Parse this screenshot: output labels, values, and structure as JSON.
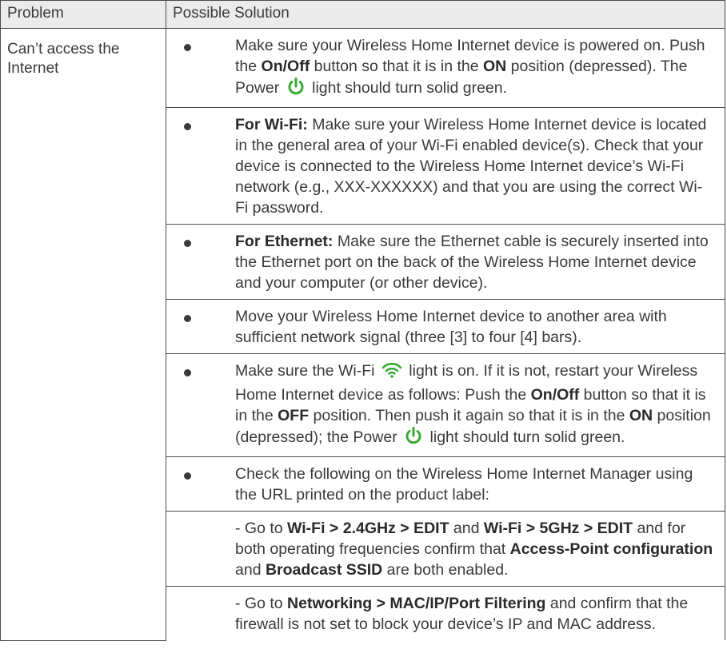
{
  "header": {
    "problem": "Problem",
    "solution": "Possible Solution"
  },
  "problem": "Can’t access the Internet",
  "items": [
    {
      "p1": "Make sure your Wireless Home Internet device is powered on. Push the ",
      "b1": "On/Off",
      "p2": " button so that it is in the ",
      "b2": "ON",
      "p3": " position (depressed). The Power ",
      "p4": " light should turn solid green."
    },
    {
      "b1": "For Wi-Fi:",
      "p1": " Make sure your Wireless Home Internet device is located in the general area of your Wi-Fi enabled device(s). Check that your device is connected to the Wireless Home Internet device’s Wi-Fi network (e.g., XXX-XXXXXX) and that you are using the correct Wi-Fi password."
    },
    {
      "b1": "For Ethernet:",
      "p1": " Make sure the Ethernet cable is securely inserted into the Ethernet port on the back of the Wireless Home Internet device and your computer (or other device)."
    },
    {
      "p1": "Move your Wireless Home Internet device to another area with sufficient network signal (three [3] to four [4] bars)."
    },
    {
      "p1": "Make sure the Wi-Fi ",
      "p2": " light is on. If it is not, restart your Wireless Home Internet device as follows: Push the ",
      "b1": "On/Off",
      "p3": " button so that it is in the ",
      "b2": "OFF",
      "p4": " position. Then push it again so that it is in the ",
      "b3": "ON",
      "p5": " position (depressed); the Power ",
      "p6": " light should turn solid green."
    },
    {
      "p1": "Check the following on the Wireless Home Internet Manager using the URL printed on the product label:"
    }
  ],
  "subitems": [
    {
      "p1": "- Go to ",
      "b1": "Wi-Fi > 2.4GHz > EDIT",
      "p2": " and ",
      "b2": "Wi-Fi > 5GHz > EDIT",
      "p3": " and for both operating frequencies confirm that ",
      "b3": "Access-Point configuration",
      "p4": " and ",
      "b4": "Broadcast SSID",
      "p5": " are both enabled."
    },
    {
      "p1": "- Go to ",
      "b1": "Networking > MAC/IP/Port Filtering",
      "p2": " and confirm that the firewall is not set to block your device’s IP and MAC address."
    }
  ],
  "colors": {
    "icon_green": "#3aaa35",
    "header_bg": "#ebebeb",
    "border": "#4a4a4a"
  },
  "icons": {
    "power": "power-icon",
    "wifi": "wifi-icon"
  }
}
